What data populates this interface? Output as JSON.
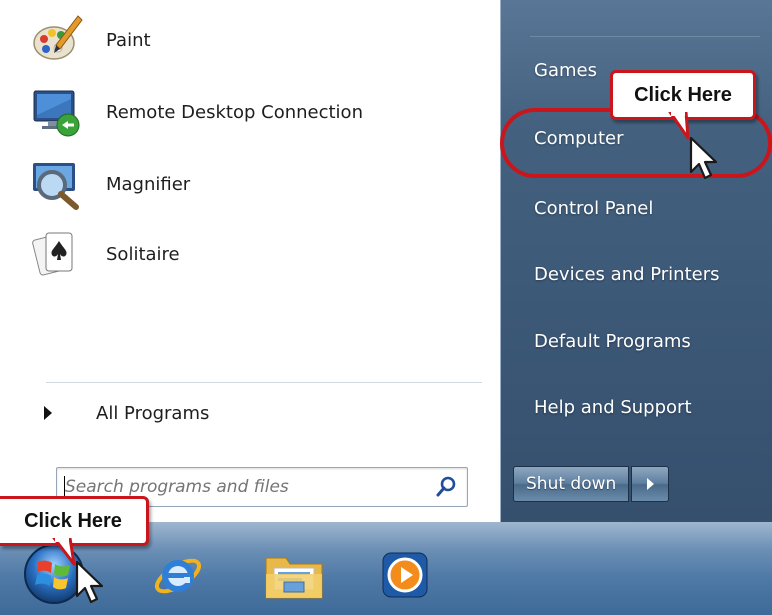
{
  "start_menu": {
    "programs": [
      {
        "label": "Paint",
        "icon": "paint-palette-icon"
      },
      {
        "label": "Remote Desktop Connection",
        "icon": "remote-desktop-icon"
      },
      {
        "label": "Magnifier",
        "icon": "magnifier-icon"
      },
      {
        "label": "Solitaire",
        "icon": "solitaire-cards-icon"
      }
    ],
    "all_programs_label": "All Programs",
    "search_placeholder": "Search programs and files",
    "right_links": [
      {
        "label": "Games"
      },
      {
        "label": "Computer"
      },
      {
        "label": "Control Panel"
      },
      {
        "label": "Devices and Printers"
      },
      {
        "label": "Default Programs"
      },
      {
        "label": "Help and Support"
      }
    ],
    "shutdown_label": "Shut down"
  },
  "callouts": {
    "computer_callout": "Click Here",
    "start_callout": "Click Here"
  },
  "taskbar": {
    "items": [
      {
        "icon": "windows-start-orb-icon"
      },
      {
        "icon": "internet-explorer-icon"
      },
      {
        "icon": "windows-explorer-folder-icon"
      },
      {
        "icon": "media-player-icon"
      }
    ]
  },
  "colors": {
    "callout_border": "#c9161c",
    "right_pane": "#3c5877",
    "taskbar": "#4f79a6"
  }
}
